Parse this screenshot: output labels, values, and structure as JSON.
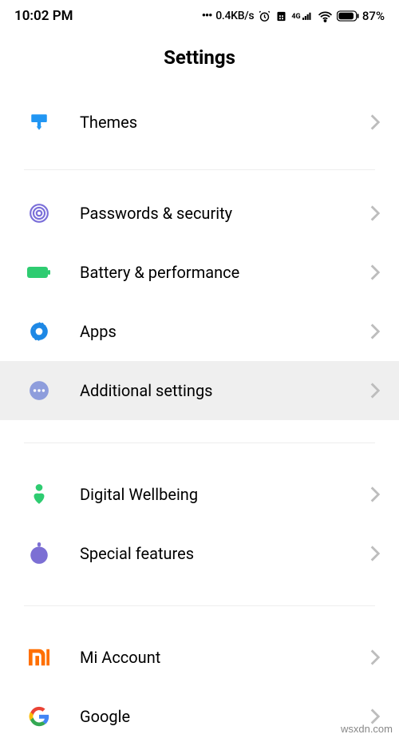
{
  "statusBar": {
    "time": "10:02 PM",
    "speed": "0.4KB/s",
    "networkLabel": "4G",
    "battery": "87%"
  },
  "page": {
    "title": "Settings"
  },
  "items": {
    "themes": "Themes",
    "passwords": "Passwords & security",
    "battery": "Battery & performance",
    "apps": "Apps",
    "additional": "Additional settings",
    "wellbeing": "Digital Wellbeing",
    "special": "Special features",
    "miaccount": "Mi Account",
    "google": "Google"
  },
  "watermark": "wsxdn.com"
}
